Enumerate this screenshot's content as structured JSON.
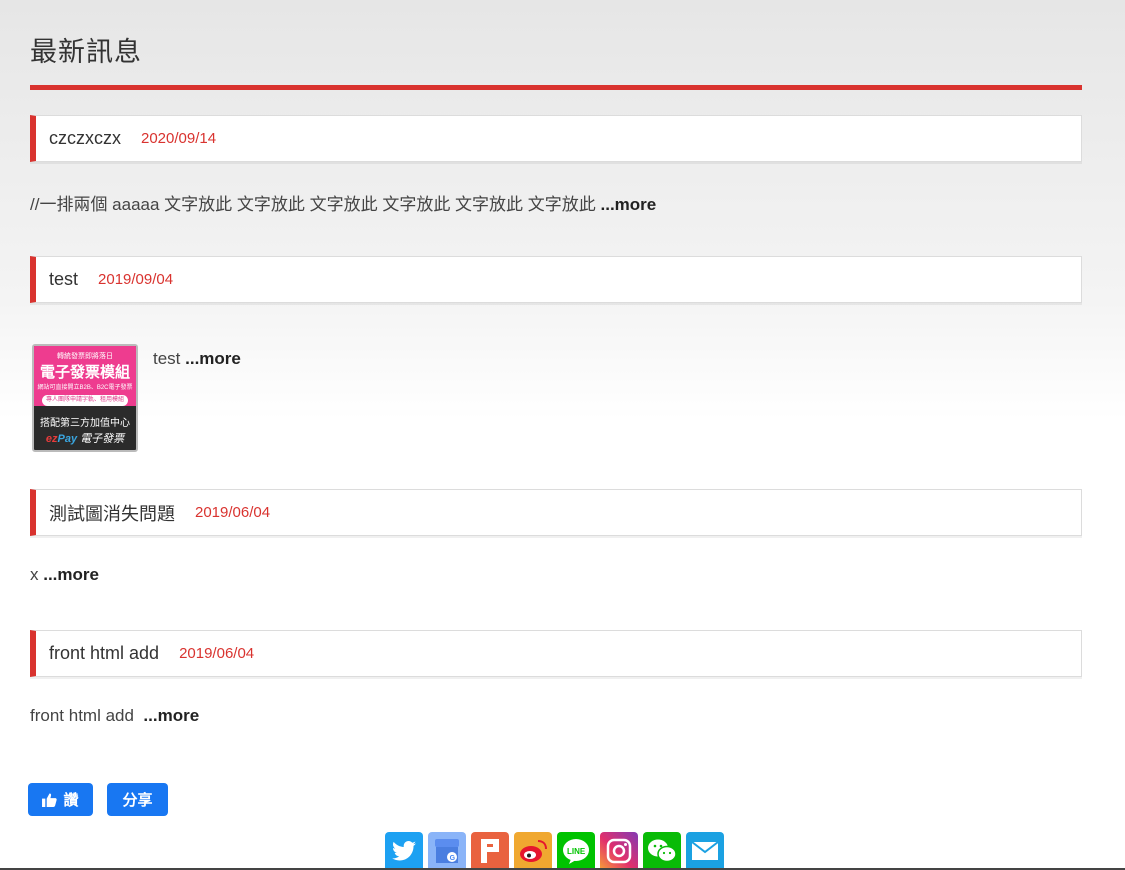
{
  "page": {
    "title": "最新訊息"
  },
  "news": [
    {
      "title": "czczxczx",
      "date": "2020/09/14",
      "excerpt": "//一排兩個 aaaaa 文字放此 文字放此 文字放此 文字放此 文字放此 文字放此",
      "more": "...more"
    },
    {
      "title": "test",
      "date": "2019/09/04",
      "excerpt": "test",
      "more": "...more",
      "thumbnail": {
        "line1": "轉統發票即將落日",
        "line2": "電子發票模組",
        "line3": "網站可直接開立B2B、B2C電子發票",
        "pill": "專人團隊申請字軌、租用模組",
        "line4": "搭配第三方加值中心",
        "brand_ez": "ez",
        "brand_pay": "Pay",
        "brand_rest": " 電子發票"
      }
    },
    {
      "title": "測試圖消失問題",
      "date": "2019/06/04",
      "excerpt": "x",
      "more": "...more"
    },
    {
      "title": "front html add",
      "date": "2019/06/04",
      "excerpt": "front html add",
      "more": "...more"
    }
  ],
  "social": {
    "like_label": "讚",
    "share_label": "分享"
  },
  "share_icons": [
    {
      "name": "twitter-icon",
      "color": "#1da1f2"
    },
    {
      "name": "google-my-business-icon",
      "color": "#8ab4f8"
    },
    {
      "name": "plurk-icon",
      "color": "#e9623f"
    },
    {
      "name": "weibo-icon",
      "color": "#f0a830"
    },
    {
      "name": "line-icon",
      "color": "#00c300"
    },
    {
      "name": "instagram-icon",
      "color": "#c13584"
    },
    {
      "name": "wechat-icon",
      "color": "#09bb07"
    },
    {
      "name": "email-icon",
      "color": "#1ba1e2"
    }
  ],
  "colors": {
    "accent": "#d9332f",
    "facebook_blue": "#1877f2"
  }
}
